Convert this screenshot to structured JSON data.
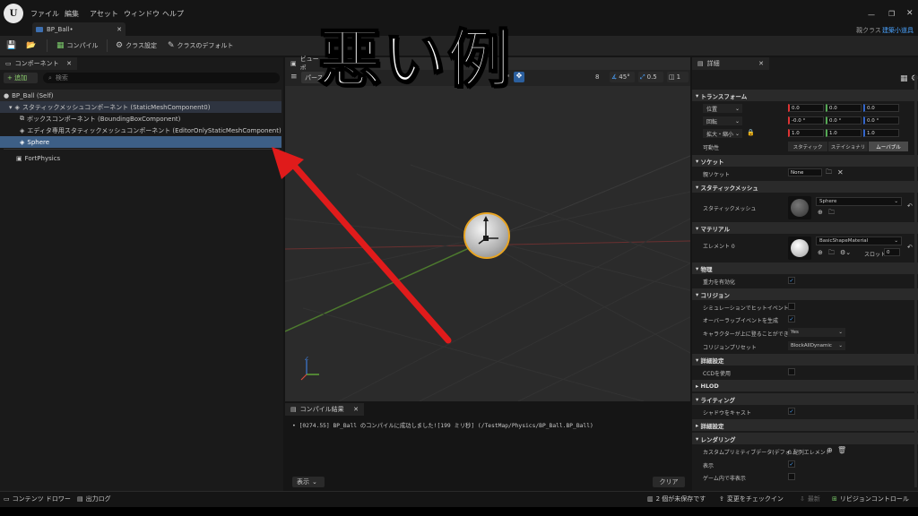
{
  "menubar": {
    "logo": "U",
    "items": [
      "ファイル",
      "編集",
      "アセット",
      "ウィンドウ",
      "ヘルプ"
    ],
    "parent_class_label": "親クラス",
    "parent_class_value": "建築小道具"
  },
  "tab": {
    "label": "BP_Ball•"
  },
  "toolbar": {
    "compile": "コンパイル",
    "class_settings": "クラス設定",
    "class_defaults": "クラスのデフォルト"
  },
  "components_panel": {
    "title": "コンポーネント",
    "add_button": "+ 追加",
    "search_placeholder": "検索",
    "tree": [
      "BP_Ball (Self)",
      "スタティックメッシュコンポーネント (StaticMeshComponent0)",
      "ボックスコンポーネント (BoundingBoxComponent)",
      "エディタ専用スタティックメッシュコンポーネント (EditorOnlyStaticMeshComponent)",
      "Sphere",
      "FortPhysics"
    ]
  },
  "viewport": {
    "title": "ビューポ",
    "perspective": "パース",
    "lit": "り",
    "angle": "45°",
    "scale": "0.5",
    "cam": "1",
    "extra": "8"
  },
  "compile_results": {
    "title": "コンパイル結果",
    "message": "[0274.55] BP_Ball のコンパイルに成功しました![199 ミリ秒] (/TestMap/Physics/BP_Ball.BP_Ball)",
    "show_button": "表示",
    "clear_button": "クリア"
  },
  "details": {
    "title": "詳細",
    "transform": {
      "header": "トランスフォーム",
      "location": {
        "label": "位置",
        "values": [
          "0.0",
          "0.0",
          "0.0"
        ]
      },
      "rotation": {
        "label": "回転",
        "values": [
          "-0.0 °",
          "0.0 °",
          "0.0 °"
        ]
      },
      "scale": {
        "label": "拡大・縮小",
        "values": [
          "1.0",
          "1.0",
          "1.0"
        ]
      },
      "mobility": {
        "label": "可動性",
        "options": [
          "スタティック",
          "ステイショナリ",
          "ムーバブル"
        ]
      }
    },
    "socket": {
      "header": "ソケット",
      "parent_label": "親ソケット",
      "parent_value": "None"
    },
    "static_mesh": {
      "header": "スタティックメッシュ",
      "label": "スタティックメッシュ",
      "value": "Sphere"
    },
    "materials": {
      "header": "マテリアル",
      "element_label": "エレメント 0",
      "value": "BasicShapeMaterial",
      "slot_label": "スロット",
      "slot_value": "0"
    },
    "physics": {
      "header": "物理",
      "gravity_label": "重力を有効化"
    },
    "collision": {
      "header": "コリジョン",
      "sim_hit_label": "シミュレーションでヒットイベント...",
      "overlap_label": "オーバーラップイベントを生成",
      "step_on_label": "キャラクターが上に登ることができ...",
      "step_on_value": "Yes",
      "preset_label": "コリジョンプリセット",
      "preset_value": "BlockAllDynamic"
    },
    "advanced": {
      "header": "詳細設定",
      "ccd_label": "CCDを使用"
    },
    "hlod": {
      "header": "HLOD"
    },
    "lighting": {
      "header": "ライティング",
      "shadow_label": "シャドウをキャスト"
    },
    "advanced2": {
      "header": "詳細設定"
    },
    "rendering": {
      "header": "レンダリング",
      "custom_label": "カスタムプリミティブデータ(デフォ...",
      "custom_value": "0 配列エレメント",
      "visible_label": "表示",
      "hidden_label": "ゲーム内で非表示"
    }
  },
  "statusbar": {
    "content_drawer": "コンテンツ ドロワー",
    "output_log": "出力ログ",
    "unsaved": "2 個が未保存です",
    "checkin": "変更をチェックイン",
    "latest": "最新",
    "revision": "リビジョンコントロール"
  },
  "overlay": {
    "text": "悪い例"
  },
  "colors": {
    "arrow": "#e01b1b",
    "selection": "#3d5f86",
    "accent": "#4aa3ff"
  }
}
